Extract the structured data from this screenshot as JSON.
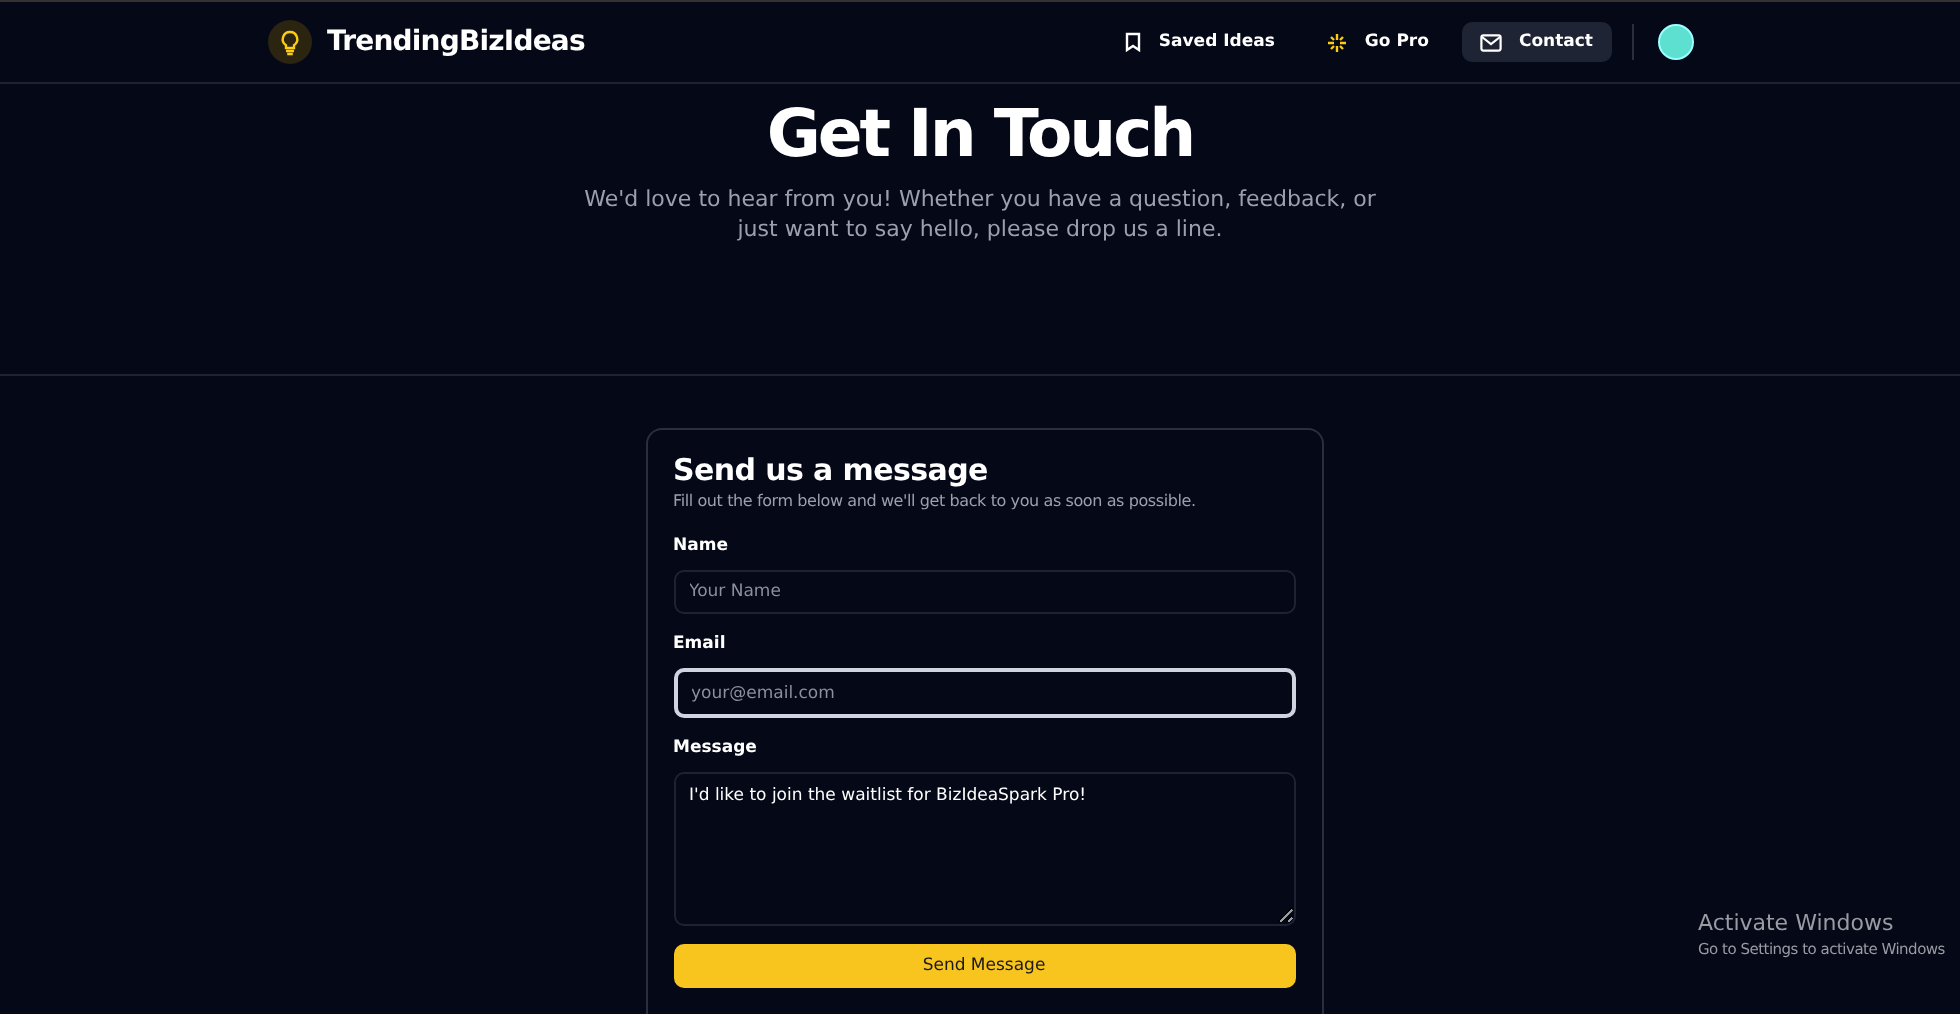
{
  "header": {
    "brand": "TrendingBizIdeas",
    "nav": [
      {
        "label": "Saved Ideas",
        "kind": "bookmark",
        "selected": false
      },
      {
        "label": "Go Pro",
        "kind": "sparkle",
        "selected": false
      },
      {
        "label": "Contact",
        "kind": "mail",
        "selected": true
      }
    ]
  },
  "hero": {
    "title": "Get In Touch",
    "subtitle": "We'd love to hear from you! Whether you have a question, feedback, or just want to say hello, please drop us a line."
  },
  "form": {
    "title": "Send us a message",
    "subtitle": "Fill out the form below and we'll get back to you as soon as possible.",
    "fields": [
      {
        "kind": "input",
        "label": "Name",
        "placeholder": "Your Name",
        "focused": false
      },
      {
        "kind": "input",
        "label": "Email",
        "placeholder": "your@email.com",
        "focused": true
      },
      {
        "kind": "textarea",
        "label": "Message",
        "value": "I'd like to join the waitlist for BizIdeaSpark Pro!",
        "focused": false
      }
    ],
    "submit": "Send Message"
  },
  "windows_notice": {
    "title": "Activate Windows",
    "text": "Go to Settings to activate Windows"
  }
}
